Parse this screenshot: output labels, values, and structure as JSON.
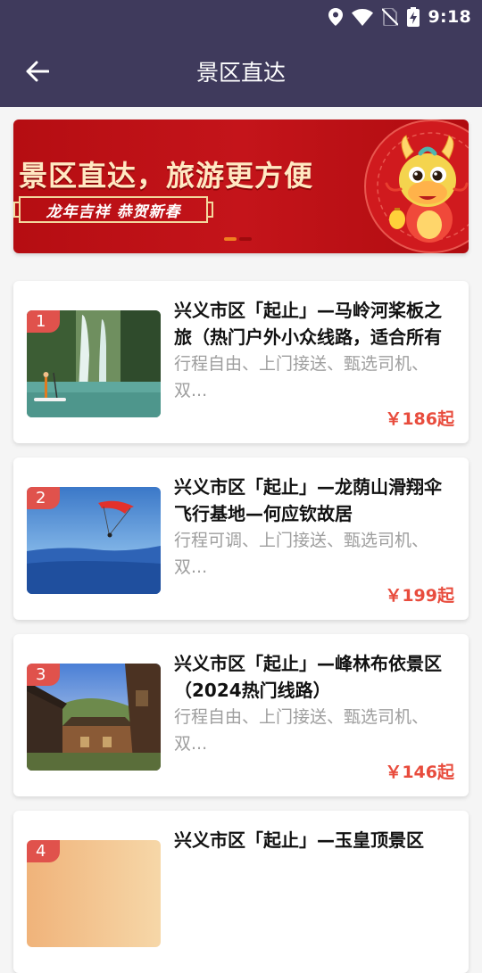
{
  "status_bar": {
    "time": "9:18",
    "icons": [
      "location-icon",
      "wifi-icon",
      "no-sim-icon",
      "battery-charging-icon"
    ]
  },
  "header": {
    "title": "景区直达",
    "back_icon": "arrow-left-icon"
  },
  "banner": {
    "title": "景区直达，旅游更方便",
    "subtitle": "龙年吉祥 恭贺新春",
    "art_icon": "dragon-mascot-icon",
    "slides_total": 2,
    "slide_active": 1
  },
  "colors": {
    "header_bg": "#3f3a5c",
    "banner_red": "#c4141a",
    "price": "#e84c3d",
    "rank_badge": "#e0524c"
  },
  "routes": [
    {
      "rank": "1",
      "title": "兴义市区「起止」—马岭河桨板之旅（热门户外小众线路，适合所有人群）",
      "desc": "行程自由、上门接送、甄选司机、双...",
      "price": "￥186起",
      "image_icon": "waterfall-paddleboard-photo"
    },
    {
      "rank": "2",
      "title": "兴义市区「起止」—龙荫山滑翔伞飞行基地—何应钦故居",
      "desc": "行程可调、上门接送、甄选司机、双...",
      "price": "￥199起",
      "image_icon": "paraglider-photo"
    },
    {
      "rank": "3",
      "title": "兴义市区「起止」—峰林布依景区（2024热门线路）",
      "desc": "行程自由、上门接送、甄选司机、双...",
      "price": "￥146起",
      "image_icon": "village-photo"
    },
    {
      "rank": "4",
      "title": "兴义市区「起止」—玉皇顶景区",
      "desc": "",
      "price": "",
      "image_icon": "sunset-photo"
    }
  ]
}
